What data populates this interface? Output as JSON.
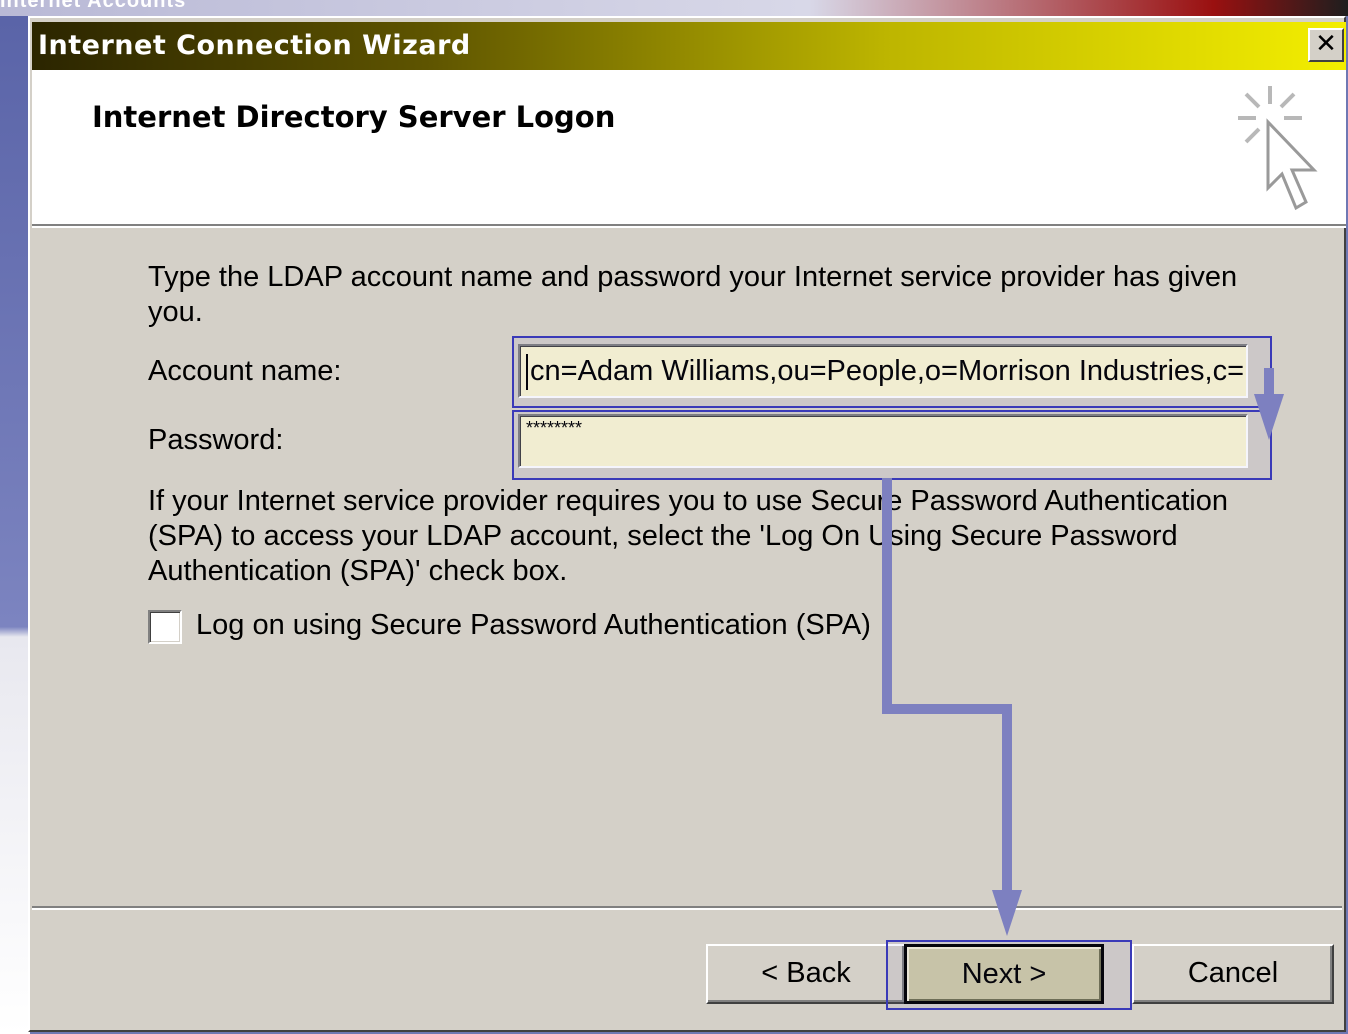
{
  "background": {
    "window_title_fragment": "Internet Accounts"
  },
  "dialog": {
    "title": "Internet Connection Wizard",
    "close_label": "✕",
    "page_title": "Internet Directory Server Logon",
    "instructions": "Type the LDAP account name and password your Internet service provider has given you.",
    "account_label": "Account name:",
    "account_value": "cn=Adam Williams,ou=People,o=Morrison Industries,c=US",
    "password_label": "Password:",
    "password_value": "********",
    "spa_text": "If your Internet service provider requires you to use Secure Password Authentication (SPA) to access your LDAP account, select the 'Log On Using Secure Password Authentication (SPA)' check box.",
    "spa_checkbox_label": "Log on using Secure Password Authentication (SPA)",
    "spa_checked": false,
    "buttons": {
      "back": "< Back",
      "next": "Next >",
      "cancel": "Cancel"
    }
  },
  "colors": {
    "title_gradient_start": "#2b2500",
    "title_gradient_end": "#f3ee00",
    "field_background": "#fbf7d2",
    "annotation": "#7d80c0"
  }
}
